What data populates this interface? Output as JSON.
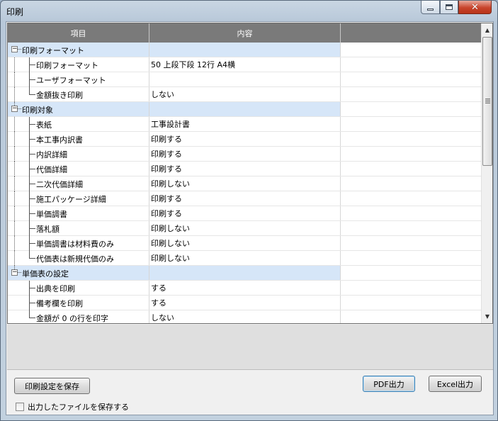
{
  "window": {
    "title": "印刷"
  },
  "grid": {
    "headers": [
      "項目",
      "内容",
      ""
    ],
    "groups": [
      {
        "label": "印刷フォーマット",
        "expander": "−",
        "items": [
          {
            "label": "印刷フォーマット",
            "value": "50 上段下段 12行 A4横"
          },
          {
            "label": "ユーザフォーマット",
            "value": ""
          },
          {
            "label": "金額抜き印刷",
            "value": "しない"
          }
        ]
      },
      {
        "label": "印刷対象",
        "expander": "−",
        "items": [
          {
            "label": "表紙",
            "value": "工事設計書"
          },
          {
            "label": "本工事内訳書",
            "value": "印刷する"
          },
          {
            "label": "内訳詳細",
            "value": "印刷する"
          },
          {
            "label": "代価詳細",
            "value": "印刷する"
          },
          {
            "label": "二次代価詳細",
            "value": "印刷しない"
          },
          {
            "label": "施工パッケージ詳細",
            "value": "印刷する"
          },
          {
            "label": "単価調書",
            "value": "印刷する"
          },
          {
            "label": "落札額",
            "value": "印刷しない"
          },
          {
            "label": "単価調書は材料費のみ",
            "value": "印刷しない"
          },
          {
            "label": "代価表は新規代価のみ",
            "value": "印刷しない"
          }
        ]
      },
      {
        "label": "単価表の設定",
        "expander": "−",
        "items": [
          {
            "label": "出典を印刷",
            "value": "する"
          },
          {
            "label": "備考欄を印刷",
            "value": "する"
          },
          {
            "label": "金額が 0 の行を印字",
            "value": "しない"
          }
        ]
      }
    ]
  },
  "buttons": {
    "save": "印刷設定を保存",
    "pdf": "PDF出力",
    "excel": "Excel出力"
  },
  "checkbox": {
    "label": "出力したファイルを保存する",
    "checked": false
  }
}
